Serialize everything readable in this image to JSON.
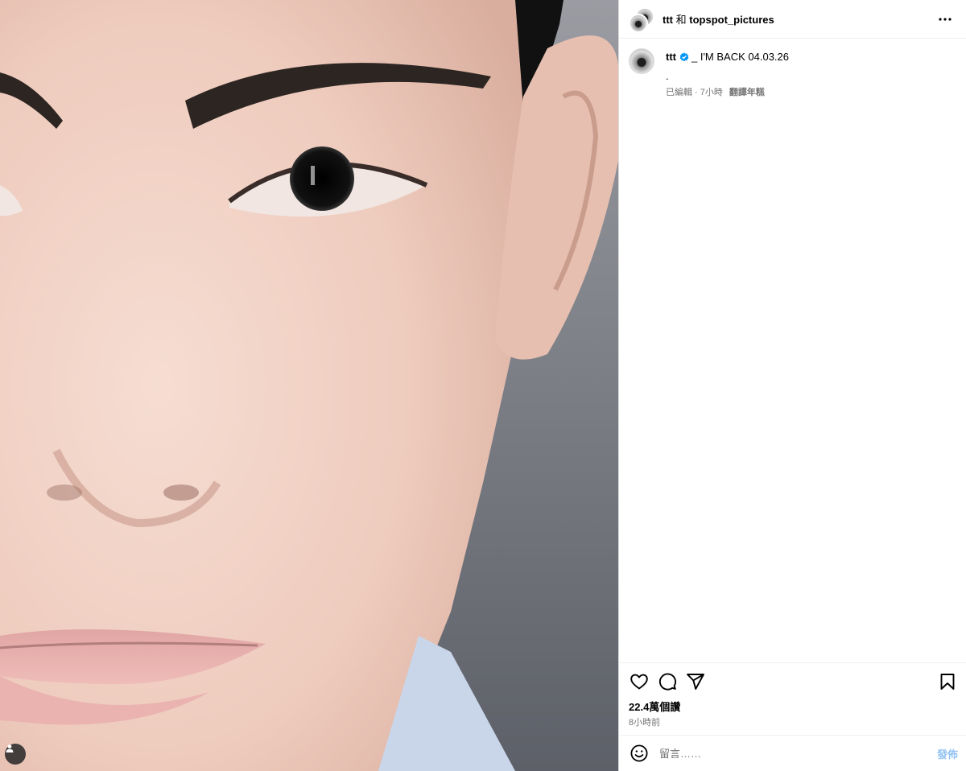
{
  "post": {
    "image_description": "close-up portrait photo",
    "header": {
      "owner": "ttt",
      "joiner": "和",
      "collaborator": "topspot_pictures"
    },
    "caption": {
      "username": "ttt",
      "text": "_ I'M BACK 04.03.26",
      "extra_line": ".",
      "edited_time": "已編輯 · 7小時",
      "translate_label": "翻譯年糕"
    },
    "likes": "22.4萬個讚",
    "posted_ago": "8小時前",
    "comment": {
      "placeholder": "留言……",
      "submit_label": "發佈"
    }
  },
  "colors": {
    "verified": "#0095f6",
    "secondary_text": "#737373",
    "post_button_disabled": "#94c3f4"
  },
  "icons": [
    "user-tag-icon",
    "more-options-icon",
    "verified-badge-icon",
    "heart-icon",
    "comment-icon",
    "share-icon",
    "bookmark-icon",
    "emoji-icon"
  ]
}
